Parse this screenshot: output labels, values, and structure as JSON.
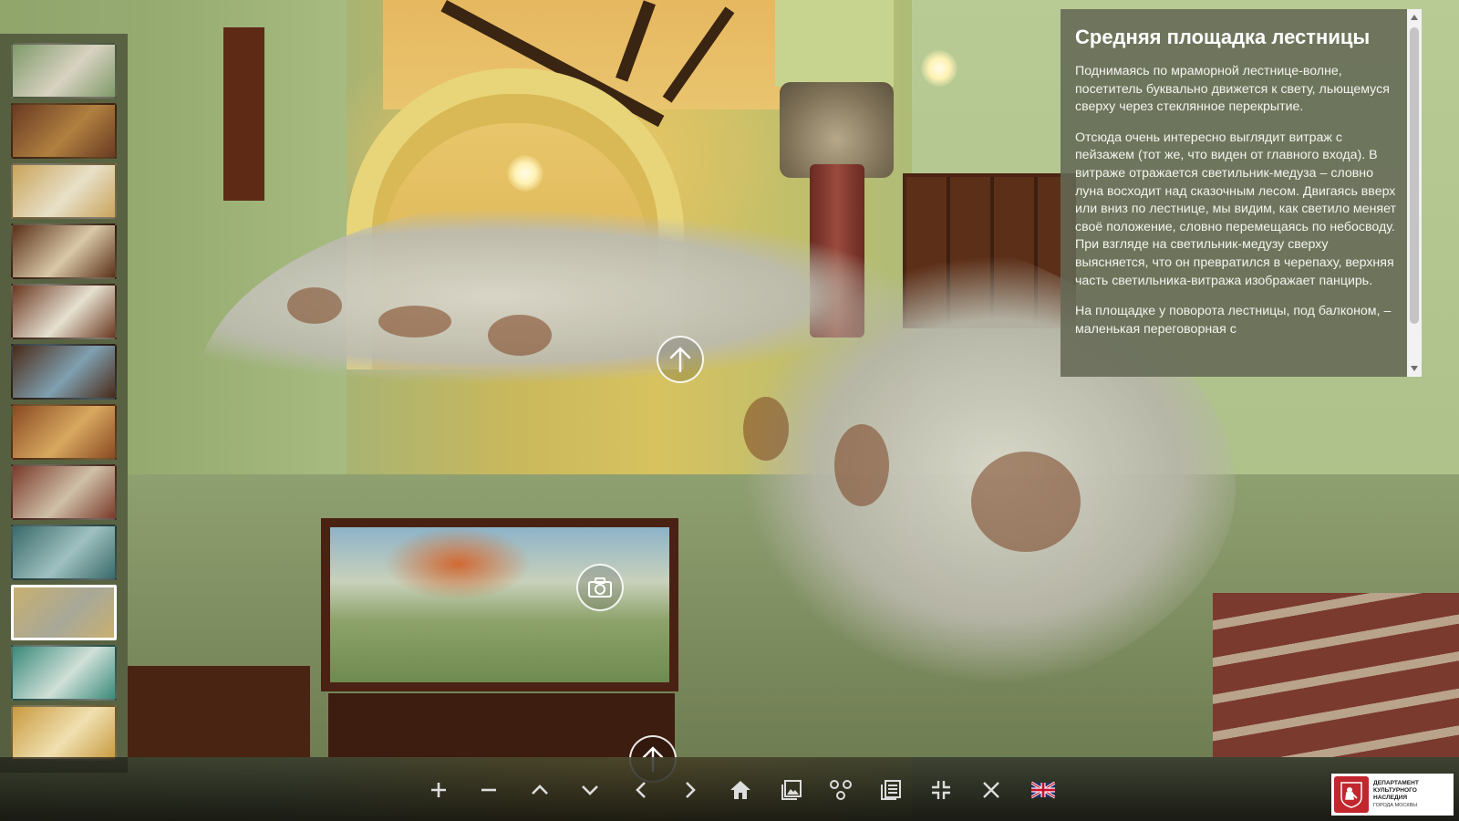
{
  "info_panel": {
    "title": "Средняя площадка лестницы",
    "paragraphs": [
      "Поднимаясь по мраморной лестнице-волне, посетитель буквально движется к свету, льющемуся сверху через стеклянное перекрытие.",
      "Отсюда очень интересно выглядит витраж с пейзажем (тот же, что виден от главного входа). В витраже отражается светильник-медуза – словно луна восходит над сказочным лесом. Двигаясь вверх или вниз по лестнице, мы видим, как светило меняет своё положение, словно перемещаясь по небосводу. При взгляде на светильник-медузу сверху выясняется, что он превратился в черепаху, верхняя часть светильника-витража изображает панцирь.",
      "На площадке у поворота лестницы, под балконом, – маленькая переговорная с"
    ]
  },
  "thumbnails": [
    {
      "icon": "exterior-thumbnail",
      "colors": [
        "#7f9a6a",
        "#d8d2c0"
      ]
    },
    {
      "icon": "hall-thumbnail",
      "colors": [
        "#6a3a22",
        "#b08040"
      ]
    },
    {
      "icon": "staircase-thumbnail",
      "colors": [
        "#c9a45a",
        "#e8e0c8"
      ]
    },
    {
      "icon": "dining-room-thumbnail",
      "colors": [
        "#5a3018",
        "#d9c8a8"
      ]
    },
    {
      "icon": "study-thumbnail",
      "colors": [
        "#6a3820",
        "#e6e0d0"
      ]
    },
    {
      "icon": "library-thumbnail",
      "colors": [
        "#4a2a18",
        "#7fa0b0"
      ]
    },
    {
      "icon": "cabinet-room-thumbnail",
      "colors": [
        "#8a4a22",
        "#d8a860"
      ]
    },
    {
      "icon": "bedroom-thumbnail",
      "colors": [
        "#7a3a2a",
        "#cfc0a8"
      ]
    },
    {
      "icon": "exhibit-thumbnail",
      "colors": [
        "#3a6a6a",
        "#9fc0c0"
      ]
    },
    {
      "icon": "landing-thumbnail",
      "colors": [
        "#c8b070",
        "#a8a898"
      ],
      "active": true
    },
    {
      "icon": "chapel-thumbnail",
      "colors": [
        "#3a8a7a",
        "#d0e0d8"
      ]
    },
    {
      "icon": "window-thumbnail",
      "colors": [
        "#c89a40",
        "#f0e0b0"
      ]
    }
  ],
  "hotspots": {
    "up_arrow": "arrow-up-icon",
    "camera": "camera-icon",
    "bottom_arrow": "arrow-up-icon"
  },
  "toolbar": {
    "buttons": [
      "zoom-in",
      "zoom-out",
      "tilt-up",
      "tilt-down",
      "pan-left",
      "pan-right",
      "home",
      "gallery",
      "hotspots",
      "text-panel",
      "fullscreen",
      "close",
      "english-language"
    ]
  },
  "logo": {
    "line1": "Департамент",
    "line2": "культурного",
    "line3": "наследия",
    "line4": "города Москвы"
  },
  "colors": {
    "panel_bg": "#646955",
    "toolbar_bg": "#1a1a15",
    "active_thumb_border": "#ffffff"
  }
}
